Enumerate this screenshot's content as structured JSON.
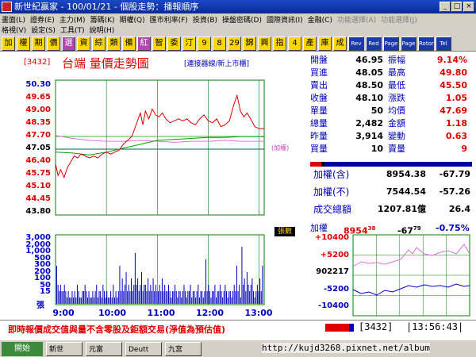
{
  "window": {
    "title": "新世紀贏家 - 100/01/21 - 個股走勢：播報順序"
  },
  "menu": {
    "row1": [
      "畫面(L)",
      "證券(E)",
      "主力(M)",
      "籌碼(K)",
      "期權(Q)",
      "匯市利率(F)",
      "投資(B)",
      "操盤密碼(D)",
      "國際資訊(I)",
      "金融(C)",
      "功能選擇(A)",
      "功能選擇(J)"
    ],
    "row2": [
      "格視(V)",
      "設定(S)",
      "工具(T)",
      "說明(H)"
    ]
  },
  "toolbar": {
    "buttons": [
      "加",
      "權",
      "期",
      "價",
      "選",
      "資",
      "綜",
      "類",
      "備",
      "紅",
      "智",
      "委",
      "汀",
      "9",
      "8",
      "29",
      "錦",
      "興",
      "指",
      "4",
      "產",
      "庫",
      "成",
      "Rev",
      "Red",
      "Page",
      "Page",
      "Rotor",
      "Tel"
    ]
  },
  "header": {
    "code": "[3432]",
    "name": "台端",
    "title": "量價走勢圖",
    "sub": "[連接器線/新上市櫃]"
  },
  "price_axis": [
    {
      "v": "50.30",
      "c": "b"
    },
    {
      "v": "49.65",
      "c": "r"
    },
    {
      "v": "49.00",
      "c": "r"
    },
    {
      "v": "48.35",
      "c": "r"
    },
    {
      "v": "47.70",
      "c": "r"
    },
    {
      "v": "47.05",
      "c": "k"
    },
    {
      "v": "46.40",
      "c": "r"
    },
    {
      "v": "45.75",
      "c": "r"
    },
    {
      "v": "45.10",
      "c": "r"
    },
    {
      "v": "44.45",
      "c": "r"
    },
    {
      "v": "43.80",
      "c": "k"
    }
  ],
  "weight_label": "(加權)",
  "volume_badge": "張數",
  "vol_axis": [
    "3,000",
    "2,000",
    "1,000",
    "500",
    "300",
    "200",
    "100",
    "50",
    "15"
  ],
  "vol_unit": "張",
  "time_labels": [
    "9:00",
    "10:00",
    "11:00",
    "12:00",
    "13:00"
  ],
  "quote": [
    {
      "l1": "開盤",
      "v1": "46.95",
      "l2": "振幅",
      "v2": "9.14%"
    },
    {
      "l1": "買進",
      "v1": "48.05",
      "l2": "最高",
      "v2": "49.80"
    },
    {
      "l1": "賣出",
      "v1": "48.50",
      "l2": "最低",
      "v2": "45.50"
    },
    {
      "l1": "收盤",
      "v1": "48.10",
      "l2": "漲跌",
      "v2": "1.05"
    },
    {
      "l1": "單量",
      "v1": "50",
      "l2": "均價",
      "v2": "47.69"
    },
    {
      "l1": "總量",
      "v1": "2,482",
      "l2": "金額",
      "v2": "1.18"
    },
    {
      "l1": "昨量",
      "v1": "3,914",
      "l2": "變動",
      "v2": "0.63"
    },
    {
      "l1": "買量",
      "v1": "10",
      "l2": "賣量",
      "v2": "9"
    }
  ],
  "index": [
    {
      "l": "加權(含)",
      "a": "8954.38",
      "b": "-67.79"
    },
    {
      "l": "加權(不)",
      "a": "7544.54",
      "b": "-57.26"
    },
    {
      "l": "成交總額",
      "a": "1207.81億",
      "b": "26.4"
    }
  ],
  "mini": {
    "label": "加權",
    "value": "8954",
    "sup": "38",
    "chg": "-67",
    "chgsup": "79",
    "pct": "-0.75%",
    "axis": [
      "+10400",
      "+5200",
      "902217",
      "-5200",
      "-10400"
    ]
  },
  "status": {
    "message": "即時報價成交值與量不含零股及鉅額交易(淨值為預估值)",
    "code": "3432",
    "time": "13:56:43"
  },
  "taskbar": {
    "start": "開始",
    "tasks": [
      "新世",
      "元富",
      "Deutt",
      "九宮"
    ]
  },
  "watermark": "http://kujd3268.pixnet.net/album",
  "chart_data": {
    "type": "line",
    "ylim": [
      43.8,
      50.3
    ],
    "price": [
      [
        0,
        46.3
      ],
      [
        3,
        45.7
      ],
      [
        6,
        46.0
      ],
      [
        10,
        45.6
      ],
      [
        14,
        46.1
      ],
      [
        18,
        46.4
      ],
      [
        22,
        46.7
      ],
      [
        26,
        46.6
      ],
      [
        30,
        46.8
      ],
      [
        35,
        46.7
      ],
      [
        40,
        46.6
      ],
      [
        45,
        46.7
      ],
      [
        50,
        46.6
      ],
      [
        55,
        46.8
      ],
      [
        60,
        46.9
      ],
      [
        65,
        46.8
      ],
      [
        70,
        46.9
      ],
      [
        75,
        47.0
      ],
      [
        80,
        47.3
      ],
      [
        85,
        47.5
      ],
      [
        90,
        47.7
      ],
      [
        95,
        48.3
      ],
      [
        100,
        48.9
      ],
      [
        103,
        48.3
      ],
      [
        106,
        49.0
      ],
      [
        110,
        48.6
      ],
      [
        114,
        49.1
      ],
      [
        118,
        48.8
      ],
      [
        122,
        48.7
      ],
      [
        126,
        48.9
      ],
      [
        130,
        48.6
      ],
      [
        135,
        48.4
      ],
      [
        140,
        48.5
      ],
      [
        145,
        48.6
      ],
      [
        150,
        48.5
      ],
      [
        155,
        48.6
      ],
      [
        160,
        48.4
      ],
      [
        165,
        48.3
      ],
      [
        170,
        48.6
      ],
      [
        175,
        48.8
      ],
      [
        180,
        48.5
      ],
      [
        185,
        48.4
      ],
      [
        190,
        48.6
      ],
      [
        195,
        48.2
      ],
      [
        200,
        48.3
      ],
      [
        205,
        48.5
      ],
      [
        210,
        49.3
      ],
      [
        214,
        49.8
      ],
      [
        218,
        49.0
      ],
      [
        222,
        48.7
      ],
      [
        226,
        48.9
      ],
      [
        230,
        48.6
      ],
      [
        235,
        48.2
      ],
      [
        240,
        48.1
      ],
      [
        246,
        48.1
      ]
    ],
    "avg": [
      [
        0,
        46.9
      ],
      [
        20,
        46.85
      ],
      [
        40,
        46.75
      ],
      [
        60,
        46.9
      ],
      [
        80,
        47.1
      ],
      [
        100,
        47.3
      ],
      [
        120,
        47.5
      ],
      [
        140,
        47.55
      ],
      [
        160,
        47.6
      ],
      [
        180,
        47.65
      ],
      [
        200,
        47.65
      ],
      [
        220,
        47.7
      ],
      [
        246,
        47.69
      ]
    ],
    "reference": 47.05,
    "weighted": [
      [
        0,
        47.75
      ],
      [
        20,
        47.6
      ],
      [
        40,
        47.5
      ],
      [
        60,
        47.45
      ],
      [
        80,
        47.45
      ],
      [
        100,
        47.5
      ],
      [
        120,
        47.45
      ],
      [
        140,
        47.4
      ],
      [
        160,
        47.45
      ],
      [
        180,
        47.45
      ],
      [
        200,
        47.5
      ],
      [
        220,
        47.45
      ],
      [
        246,
        47.45
      ]
    ],
    "volume": [
      6,
      3,
      2,
      3,
      2,
      2,
      3,
      2,
      1,
      2,
      1,
      1,
      2,
      1,
      2,
      1,
      3,
      2,
      1,
      1,
      2,
      2,
      3,
      2,
      1,
      2,
      1,
      1,
      2,
      1,
      2,
      3,
      1,
      2,
      2,
      1,
      3,
      2,
      1,
      2,
      1,
      1,
      2,
      1,
      3,
      1,
      2,
      1,
      2,
      6,
      2,
      4,
      2,
      3,
      5,
      2,
      3,
      2,
      4,
      2,
      3,
      8,
      3,
      4,
      2,
      3,
      5,
      2,
      3,
      3,
      2,
      4,
      2,
      3,
      2,
      4,
      2,
      3,
      2,
      2,
      3,
      2,
      4,
      2,
      3,
      2,
      2,
      3,
      2,
      1,
      2,
      2,
      3,
      2,
      1,
      2,
      2,
      1,
      2,
      3,
      2,
      1,
      2,
      2,
      3,
      1,
      2,
      2,
      1,
      2,
      3,
      1,
      2,
      2,
      1,
      2,
      7,
      2,
      3,
      2,
      1,
      2,
      2,
      3,
      1,
      2,
      2,
      3,
      2,
      1,
      2,
      3,
      2,
      1,
      2,
      2,
      1,
      2,
      3,
      2,
      6,
      2,
      3,
      1,
      9,
      3,
      4,
      2,
      5,
      3,
      2,
      3,
      4,
      2,
      1,
      2,
      3,
      2,
      4,
      2,
      6
    ]
  }
}
